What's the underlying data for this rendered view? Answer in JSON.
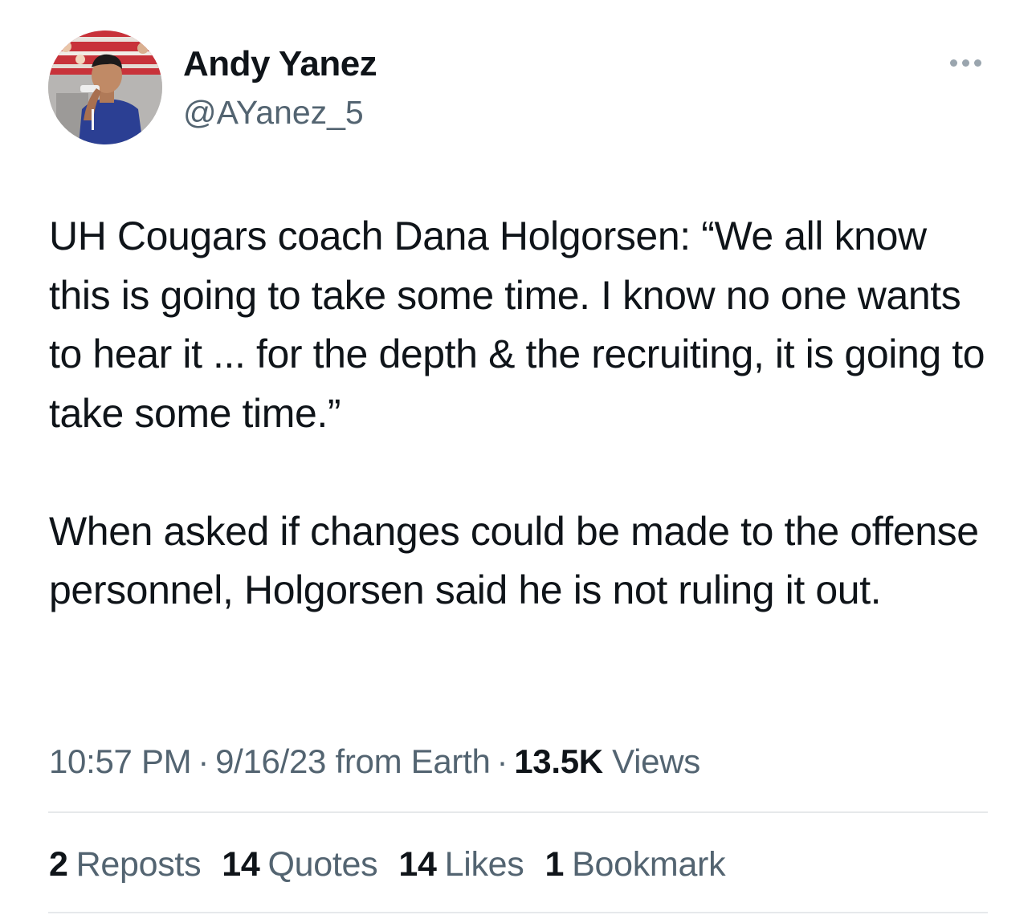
{
  "author": {
    "display_name": "Andy Yanez",
    "handle": "@AYanez_5"
  },
  "icons": {
    "more": "more-horizontal-icon",
    "avatar": "profile-photo"
  },
  "tweet": {
    "paragraphs": [
      "UH Cougars coach Dana Holgorsen: “We all know this is going to take some time. I know no one wants to hear it ... for the depth & the recruiting, it is going to take some time.”",
      "When asked if changes could be made to the offense personnel, Holgorsen said he is not ruling it out."
    ]
  },
  "meta": {
    "time": "10:57 PM",
    "separator": "·",
    "date": "9/16/23",
    "source": "from Earth",
    "views_count": "13.5K",
    "views_label": "Views"
  },
  "stats": [
    {
      "count": "2",
      "label": "Reposts"
    },
    {
      "count": "14",
      "label": "Quotes"
    },
    {
      "count": "14",
      "label": "Likes"
    },
    {
      "count": "1",
      "label": "Bookmark"
    }
  ],
  "colors": {
    "primary_text": "#0f1419",
    "secondary_text": "#536471",
    "divider": "#e6e9eb"
  }
}
